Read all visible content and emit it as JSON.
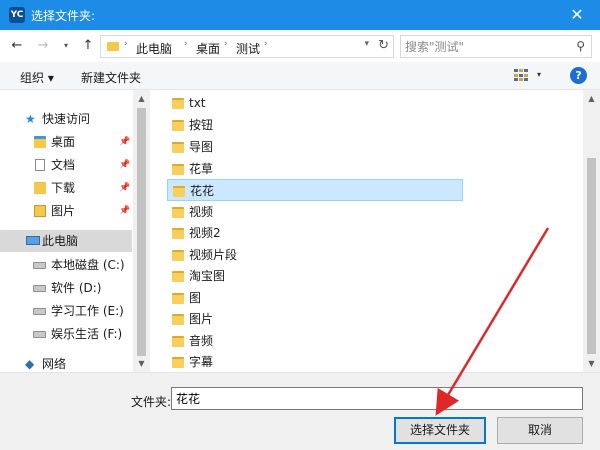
{
  "window": {
    "title": "选择文件夹:",
    "app_icon_text": "YC",
    "close_glyph": "✕"
  },
  "nav": {
    "back": "←",
    "forward": "→",
    "recent": "▾",
    "up": "↑"
  },
  "address": {
    "crumbs": [
      "此电脑",
      "桌面",
      "测试"
    ],
    "separator": "›",
    "dropdown": "▾",
    "refresh": "↻"
  },
  "search": {
    "placeholder": "搜索\"测试\"",
    "icon": "⚲"
  },
  "toolbar": {
    "organize_label": "组织 ▾",
    "new_folder_label": "新建文件夹",
    "view_dropdown": "▾",
    "help": "?"
  },
  "sidebar": {
    "items": [
      {
        "label": "快速访问",
        "icon": "star-icon"
      },
      {
        "label": "桌面",
        "icon": "desktop-folder-icon",
        "pinned": true
      },
      {
        "label": "文档",
        "icon": "document-icon",
        "pinned": true
      },
      {
        "label": "下载",
        "icon": "download-icon",
        "pinned": true
      },
      {
        "label": "图片",
        "icon": "pictures-icon",
        "pinned": true
      },
      {
        "label": "此电脑",
        "icon": "computer-icon",
        "selected": true
      },
      {
        "label": "本地磁盘 (C:)",
        "icon": "drive-icon"
      },
      {
        "label": "软件 (D:)",
        "icon": "drive-icon"
      },
      {
        "label": "学习工作 (E:)",
        "icon": "drive-icon"
      },
      {
        "label": "娱乐生活 (F:)",
        "icon": "drive-icon"
      },
      {
        "label": "网络",
        "icon": "network-icon"
      }
    ],
    "pin_glyph": "📌"
  },
  "files": [
    {
      "name": "txt"
    },
    {
      "name": "按钮"
    },
    {
      "name": "导图"
    },
    {
      "name": "花草"
    },
    {
      "name": "花花",
      "selected": true
    },
    {
      "name": "视频"
    },
    {
      "name": "视频2"
    },
    {
      "name": "视频片段"
    },
    {
      "name": "淘宝图"
    },
    {
      "name": "图"
    },
    {
      "name": "图片"
    },
    {
      "name": "音频"
    },
    {
      "name": "字幕"
    }
  ],
  "scroll": {
    "up": "▲",
    "down": "▼"
  },
  "footer": {
    "folder_label": "文件夹:",
    "folder_value": "花花",
    "select_button": "选择文件夹",
    "cancel_button": "取消"
  },
  "colors": {
    "titlebar": "#1c8ce6",
    "selection": "#cce8ff",
    "annotation_arrow": "#e02828"
  }
}
